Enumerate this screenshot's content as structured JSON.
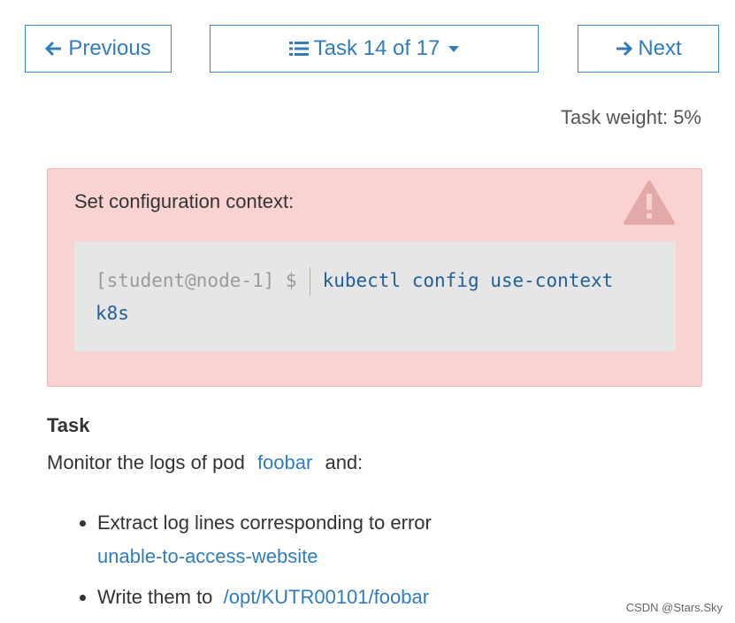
{
  "nav": {
    "prev_label": "Previous",
    "task_label": "Task 14 of 17",
    "next_label": "Next"
  },
  "task_weight": "Task weight: 5%",
  "alert": {
    "title": "Set configuration context:",
    "prompt": "[student@node-1] $",
    "command": "kubectl config use-context k8s"
  },
  "task": {
    "heading": "Task",
    "desc_prefix": "Monitor the logs of pod",
    "pod_name": "foobar",
    "desc_suffix": "and:",
    "bullets": [
      {
        "text": "Extract log lines corresponding to error",
        "code": "unable-to-access-website"
      },
      {
        "text": "Write them to",
        "code": "/opt/KUTR00101/foobar"
      }
    ]
  },
  "watermark": "CSDN @Stars.Sky",
  "colors": {
    "accent": "#2f7dbd",
    "alert_bg": "#fbd2d2",
    "code_bg": "#e6e6e6"
  }
}
